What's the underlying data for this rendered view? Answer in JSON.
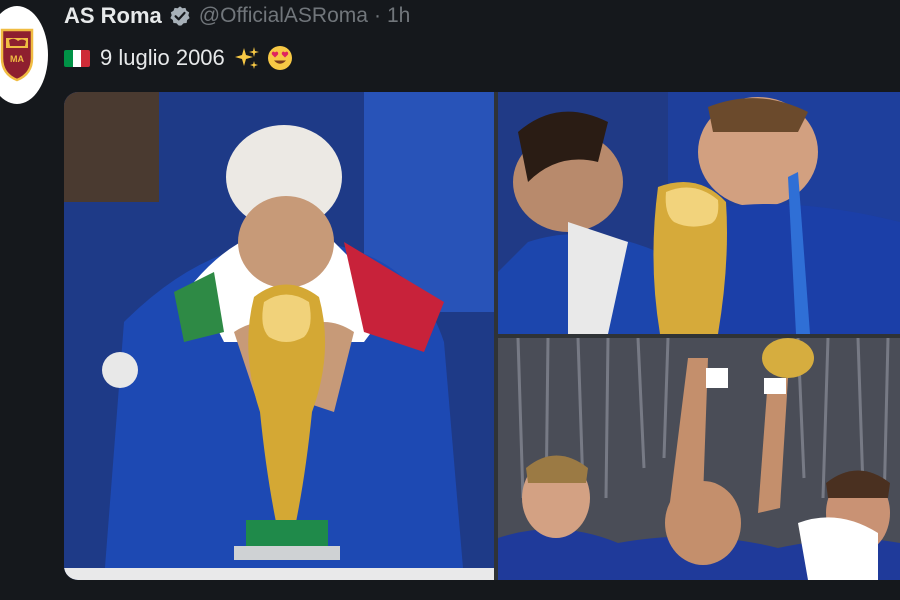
{
  "tweet": {
    "author": {
      "display_name": "AS Roma",
      "handle": "@OfficialASRoma",
      "verified": true
    },
    "separator": "·",
    "timestamp": "1h",
    "text": "9 luglio 2006",
    "text_icons": [
      "italy-flag-icon",
      "sparkles-icon",
      "heart-eyes-icon"
    ],
    "media": [
      {
        "description": "photo-world-cup-kiss-left"
      },
      {
        "description": "photo-world-cup-kiss-top-right"
      },
      {
        "description": "photo-trophy-celebration-bottom-right"
      }
    ]
  },
  "colors": {
    "background": "#15181c",
    "text_primary": "#e7e9ea",
    "text_secondary": "#71767b",
    "verified_badge": "#a7b0b8",
    "flag": [
      "#009246",
      "#ffffff",
      "#ce2b37"
    ],
    "roma_crest": [
      "#8e1f2f",
      "#f0bc42"
    ]
  }
}
